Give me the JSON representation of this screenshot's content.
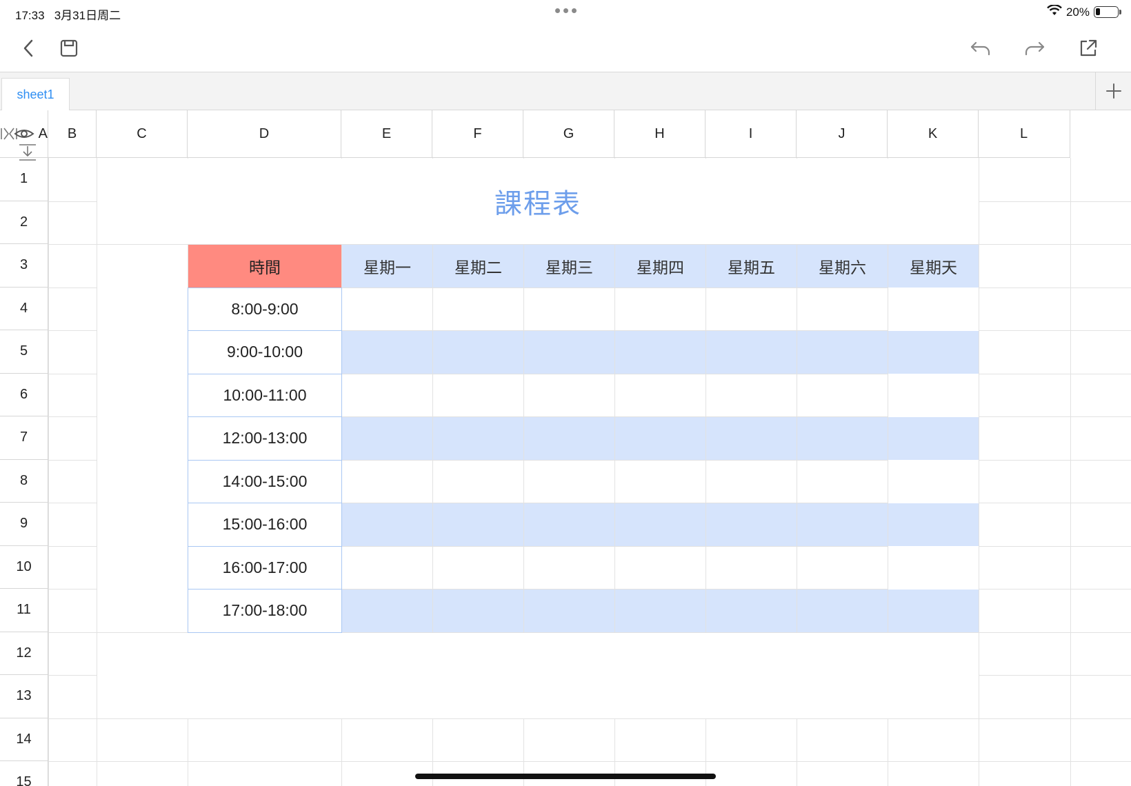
{
  "status_bar": {
    "time": "17:33",
    "date": "3月31日周二",
    "battery": "20%",
    "battery_level": 0.2
  },
  "toolbar": {
    "back_icon": "chevron-left-icon",
    "save_icon": "save-icon",
    "undo_icon": "undo-icon",
    "redo_icon": "redo-icon",
    "share_icon": "share-icon"
  },
  "sheet_tabs": {
    "active": "sheet1",
    "add_icon": "plus-icon"
  },
  "grid": {
    "columns": [
      "A",
      "B",
      "C",
      "D",
      "E",
      "F",
      "G",
      "H",
      "I",
      "J",
      "K",
      "L"
    ],
    "rows": [
      "1",
      "2",
      "3",
      "4",
      "5",
      "6",
      "7",
      "8",
      "9",
      "10",
      "11",
      "12",
      "13",
      "14",
      "15"
    ]
  },
  "timetable": {
    "title": "課程表",
    "time_header": "時間",
    "days": [
      "星期一",
      "星期二",
      "星期三",
      "星期四",
      "星期五",
      "星期六",
      "星期天"
    ],
    "slots": [
      "8:00-9:00",
      "9:00-10:00",
      "10:00-11:00",
      "12:00-13:00",
      "14:00-15:00",
      "15:00-16:00",
      "16:00-17:00",
      "17:00-18:00"
    ]
  },
  "colors": {
    "accent": "#2f8ef2",
    "title": "#6d9eeb",
    "time_header_bg": "#ff8a80",
    "day_header_bg": "#d6e4fc",
    "band_bg": "#d6e4fc"
  }
}
